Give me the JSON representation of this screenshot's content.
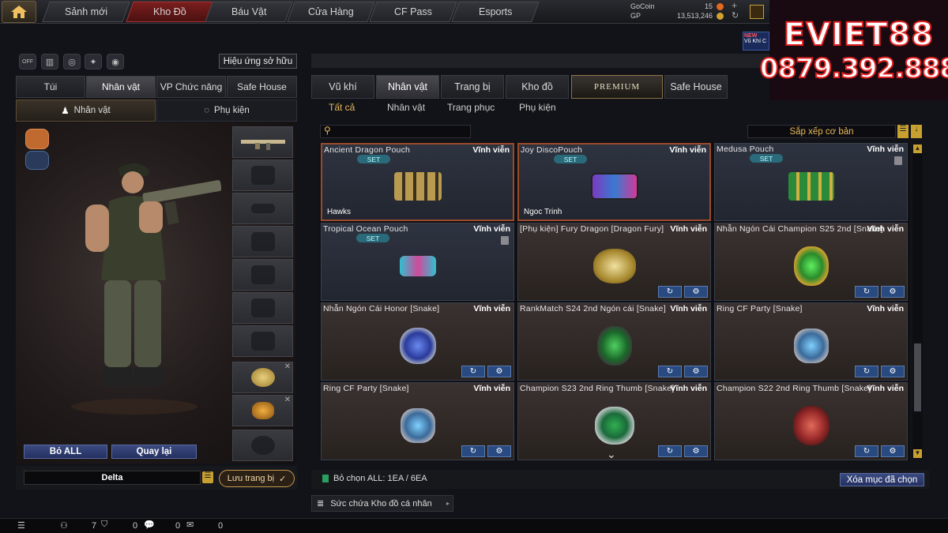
{
  "nav": {
    "tabs": [
      "Sảnh mới",
      "Kho Đồ",
      "Báu Vật",
      "Cửa Hàng",
      "CF Pass",
      "Esports"
    ]
  },
  "currency": {
    "gocoin_label": "GoCoin",
    "gocoin": "15",
    "gp_label": "GP",
    "gp": "13,513,246"
  },
  "promo": {
    "line1": "EVIET88",
    "line2": "0879.392.888",
    "badge": "NEW",
    "badge_sub": "Vũ Khí C"
  },
  "left": {
    "effect_button": "Hiệu ứng sở hữu",
    "toggle_label": "OFF",
    "tabs": [
      "Túi",
      "Nhân vật",
      "VP Chức năng",
      "Safe House"
    ],
    "subtabs": [
      "Nhân vật",
      "Phụ kiện"
    ],
    "buttons": {
      "all": "Bỏ ALL",
      "back": "Quay lại",
      "save": "Lưu trang bị"
    },
    "preset": "Delta"
  },
  "right": {
    "tabs": [
      "Vũ khí",
      "Nhân vật",
      "Trang bị",
      "Kho đồ",
      "PREMIUM",
      "Safe House"
    ],
    "filters": [
      "Tất cả",
      "Nhân vật",
      "Trang phục",
      "Phụ kiện"
    ],
    "sort": "Sắp xếp cơ bản",
    "items": [
      {
        "name": "Ancient Dragon Pouch",
        "duration": "Vĩnh viễn",
        "set": "SET",
        "owner": "Hawks"
      },
      {
        "name": "Joy DiscoPouch",
        "duration": "Vĩnh viễn",
        "set": "SET",
        "owner": "Ngoc Trinh"
      },
      {
        "name": "Medusa Pouch",
        "duration": "Vĩnh viễn",
        "set": "SET"
      },
      {
        "name": "Tropical Ocean Pouch",
        "duration": "Vĩnh viễn",
        "set": "SET"
      },
      {
        "name": "[Phụ kiện] Fury Dragon [Dragon Fury]",
        "duration": "Vĩnh viễn"
      },
      {
        "name": "Nhẫn Ngón Cái Champion S25 2nd [Snake]",
        "duration": "Vĩnh viễn"
      },
      {
        "name": "Nhẫn Ngón Cái Honor [Snake]",
        "duration": "Vĩnh viễn"
      },
      {
        "name": "RankMatch S24 2nd Ngón cái [Snake]",
        "duration": "Vĩnh viễn"
      },
      {
        "name": "Ring CF Party [Snake]",
        "duration": "Vĩnh viễn"
      },
      {
        "name": "Ring CF Party [Snake]",
        "duration": "Vĩnh viễn"
      },
      {
        "name": "Champion S23 2nd Ring Thumb [Snake]",
        "duration": "Vĩnh viễn"
      },
      {
        "name": "Champion S22 2nd Ring Thumb [Snake]",
        "duration": "Vĩnh viễn"
      }
    ],
    "selected": "Bỏ chọn ALL: 1EA / 6EA",
    "clear_button": "Xóa mục đã chọn",
    "capacity": "Sức chứa Kho đồ cá nhân"
  },
  "status": {
    "count1": "7",
    "count2": "0",
    "count3": "0",
    "count4": "0"
  }
}
